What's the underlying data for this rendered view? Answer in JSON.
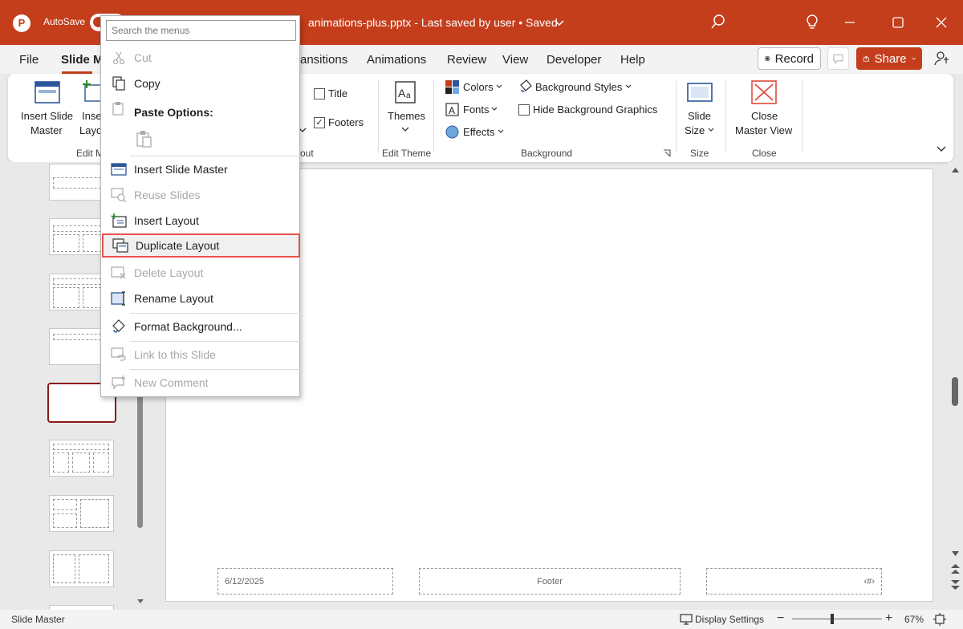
{
  "titlebar": {
    "autosave_label": "AutoSave",
    "document_title": "animations-plus.pptx  -  Last saved by user  •  Saved",
    "app_icon_letter": "P"
  },
  "menubar": {
    "tabs": [
      "File",
      "Slide M",
      "ransitions",
      "Animations",
      "Review",
      "View",
      "Developer",
      "Help"
    ],
    "active_tab": "Slide M",
    "record_label": "Record",
    "share_label": "Share"
  },
  "ribbon": {
    "insert_slide_master": [
      "Insert Slide",
      "Master"
    ],
    "insert_layout_partial": [
      "Inse",
      "Layo"
    ],
    "edit_master_group": "Edit M",
    "title_checkbox": "Title",
    "footers_checkbox": "Footers",
    "master_layout_group": "out",
    "themes_label": "Themes",
    "edit_theme_group": "Edit Theme",
    "colors_label": "Colors",
    "fonts_label": "Fonts",
    "effects_label": "Effects",
    "background_styles_label": "Background Styles",
    "hide_bg_graphics_label": "Hide Background Graphics",
    "background_group": "Background",
    "slide_size_label": [
      "Slide",
      "Size"
    ],
    "size_group": "Size",
    "close_master_label": [
      "Close",
      "Master View"
    ],
    "close_group": "Close",
    "title_checked": false,
    "footers_checked": true,
    "hide_bg_checked": false
  },
  "context_menu": {
    "search_placeholder": "Search the menus",
    "paste_options_label": "Paste Options:",
    "items": [
      {
        "label": "Cut",
        "disabled": true
      },
      {
        "label": "Copy",
        "disabled": false
      },
      {
        "label": "Insert Slide Master",
        "disabled": false
      },
      {
        "label": "Reuse Slides",
        "disabled": true
      },
      {
        "label": "Insert Layout",
        "disabled": false
      },
      {
        "label": "Duplicate Layout",
        "disabled": false,
        "highlighted": true
      },
      {
        "label": "Delete Layout",
        "disabled": true
      },
      {
        "label": "Rename Layout",
        "disabled": false
      },
      {
        "label": "Format Background...",
        "disabled": false
      },
      {
        "label": "Link to this Slide",
        "disabled": true
      },
      {
        "label": "New Comment",
        "disabled": true
      }
    ]
  },
  "slide": {
    "date_placeholder": "6/12/2025",
    "footer_placeholder": "Footer",
    "number_placeholder": "‹#›"
  },
  "statusbar": {
    "mode": "Slide Master",
    "display_settings": "Display Settings",
    "zoom": "67%",
    "zoom_fraction": 0.45
  },
  "colors": {
    "accent": "#c43e1c",
    "selected_thumb": "#8a1c1c",
    "highlight_border": "#e8514d"
  }
}
